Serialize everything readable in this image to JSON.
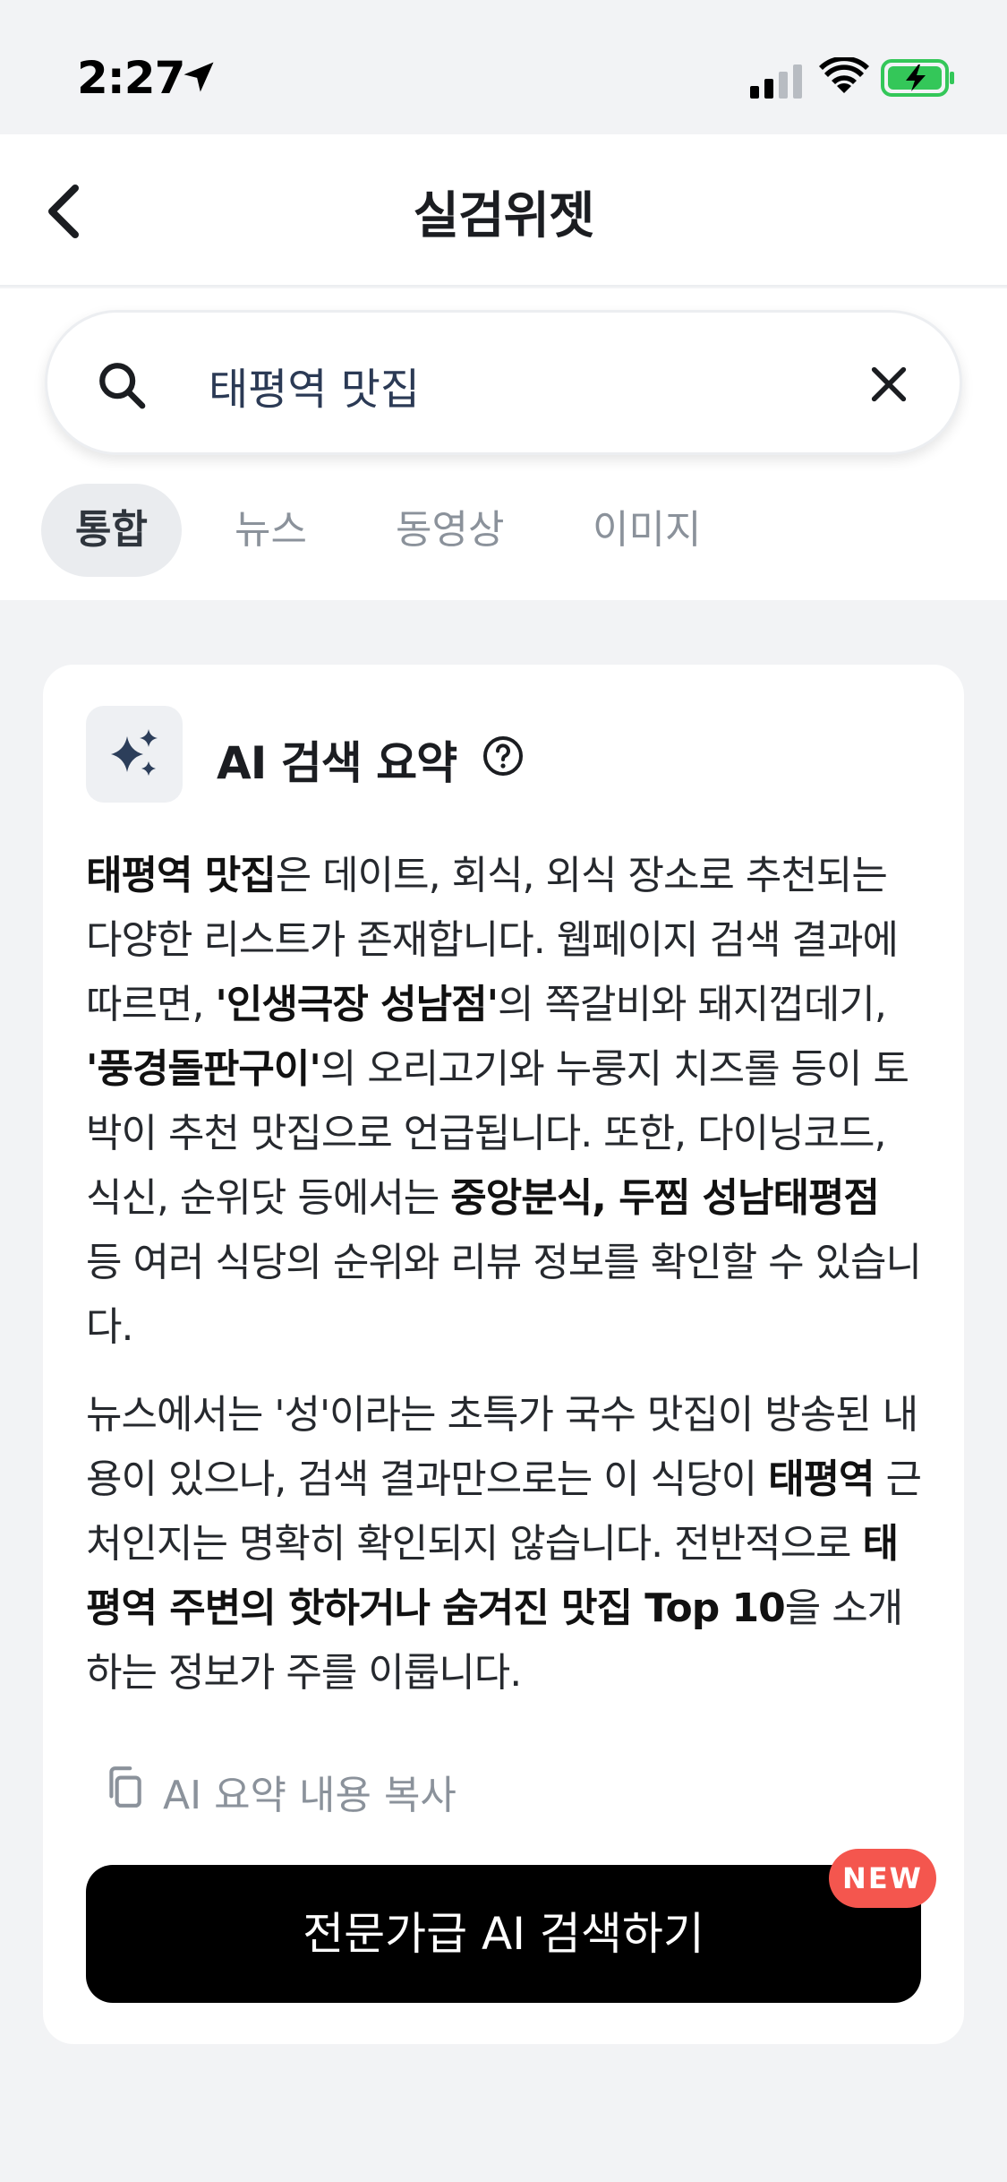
{
  "status_bar": {
    "time": "2:27",
    "icons": [
      "location-arrow-icon",
      "cellular-signal-icon",
      "wifi-icon",
      "battery-charging-icon"
    ],
    "battery_color": "#34c759"
  },
  "header": {
    "title": "실검위젯",
    "back_icon": "chevron-left-icon"
  },
  "search": {
    "value": "태평역 맛집",
    "icons": [
      "search-icon",
      "close-icon"
    ]
  },
  "tabs": [
    {
      "label": "통합",
      "active": true
    },
    {
      "label": "뉴스",
      "active": false
    },
    {
      "label": "동영상",
      "active": false
    },
    {
      "label": "이미지",
      "active": false
    }
  ],
  "ai_summary": {
    "badge_icon": "sparkles-icon",
    "title": "AI 검색 요약",
    "help_icon": "question-circle-icon",
    "p1": {
      "t1": "태평역 맛집",
      "t2": "은 데이트, 회식, 외식 장소로 추천되는 다양한 리스트가 존재합니다. 웹페이지 검색 결과에 따르면, ",
      "t3": "'인생극장 성남점'",
      "t4": "의 쪽갈비와 돼지껍데기, ",
      "t5": "'풍경돌판구이'",
      "t6": "의 오리고기와 누룽지 치즈롤 등이 토박이 추천 맛집으로 언급됩니다. 또한, 다이닝코드, 식신, 순위닷 등에서는 ",
      "t7": "중앙분식, 두찜 성남태평점",
      "t8": " 등 여러 식당의 순위와 리뷰 정보를 확인할 수 있습니다."
    },
    "p2": {
      "t1": "뉴스에서는 '성'이라는 초특가 국수 맛집이 방송된 내용이 있으나, 검색 결과만으로는 이 식당이 ",
      "t2": "태평역",
      "t3": " 근처인지는 명확히 확인되지 않습니다. 전반적으로 ",
      "t4": "태평역 주변의 핫하거나 숨겨진 맛집 Top 10",
      "t5": "을 소개하는 정보가 주를 이룹니다."
    },
    "copy_label": "AI 요약 내용 복사",
    "copy_icon": "copy-icon",
    "cta_label": "전문가급 AI 검색하기",
    "new_badge": "NEW",
    "new_badge_color": "#f4564e"
  }
}
